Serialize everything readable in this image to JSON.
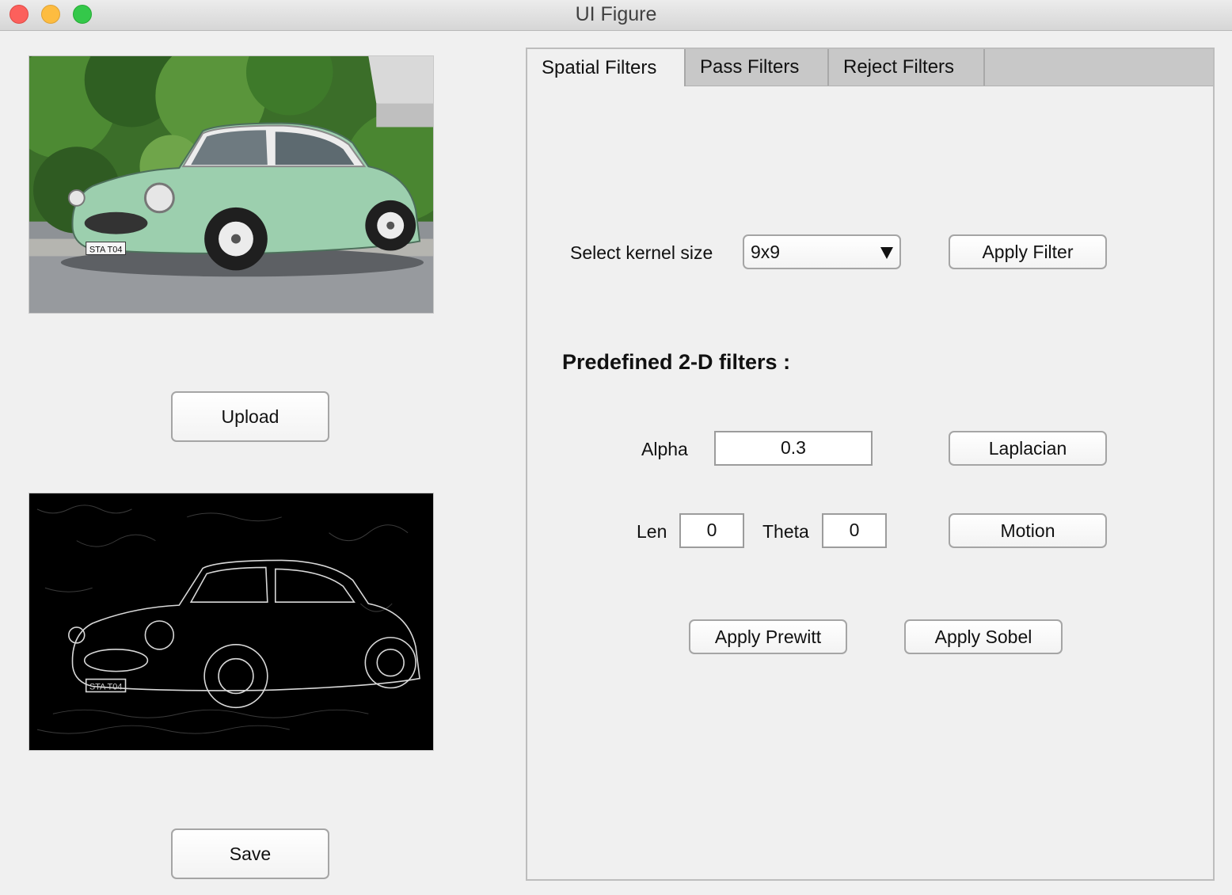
{
  "window": {
    "title": "UI Figure"
  },
  "left_panel": {
    "upload_label": "Upload",
    "save_label": "Save",
    "original_plate_text": "STA T04",
    "filtered_plate_text": "STA T04"
  },
  "tabs": [
    {
      "label": "Spatial Filters",
      "active": true
    },
    {
      "label": "Pass Filters",
      "active": false
    },
    {
      "label": "Reject Filters",
      "active": false
    }
  ],
  "spatial": {
    "kernel_label": "Select kernel size",
    "kernel_value": "9x9",
    "apply_filter_label": "Apply Filter",
    "predefined_heading": "Predefined 2-D filters :",
    "alpha_label": "Alpha",
    "alpha_value": "0.3",
    "laplacian_label": "Laplacian",
    "len_label": "Len",
    "len_value": "0",
    "theta_label": "Theta",
    "theta_value": "0",
    "motion_label": "Motion",
    "prewitt_label": "Apply Prewitt",
    "sobel_label": "Apply Sobel"
  },
  "icons": {
    "close": "close-window-icon",
    "minimize": "minimize-window-icon",
    "maximize": "maximize-window-icon",
    "dropdown": "chevron-down-icon"
  },
  "colors": {
    "close": "#fc605c",
    "minimize": "#fdbc40",
    "maximize": "#34c84a",
    "car_body": "#9ccfae",
    "car_roof": "#ececec",
    "foliage": "#3f7a2c"
  }
}
